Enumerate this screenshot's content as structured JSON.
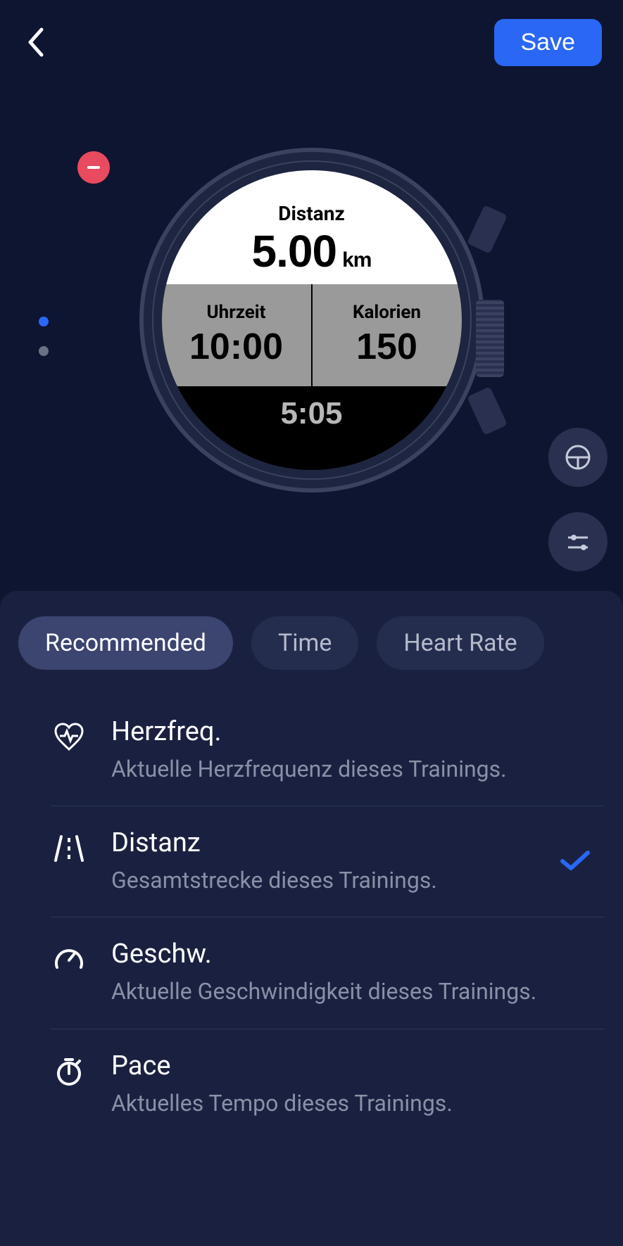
{
  "header": {
    "save_label": "Save"
  },
  "watch": {
    "top": {
      "label": "Distanz",
      "value": "5.00",
      "unit": "km"
    },
    "mid_left": {
      "label": "Uhrzeit",
      "value": "10:00"
    },
    "mid_right": {
      "label": "Kalorien",
      "value": "150"
    },
    "bottom": {
      "value": "5:05"
    }
  },
  "tabs": [
    "Recommended",
    "Time",
    "Heart Rate"
  ],
  "items": [
    {
      "title": "Herzfreq.",
      "desc": "Aktuelle Herzfrequenz dieses Trainings.",
      "selected": false
    },
    {
      "title": "Distanz",
      "desc": "Gesamtstrecke dieses Trainings.",
      "selected": true
    },
    {
      "title": "Geschw.",
      "desc": "Aktuelle Geschwindigkeit dieses Trainings.",
      "selected": false
    },
    {
      "title": "Pace",
      "desc": "Aktuelles Tempo dieses Trainings.",
      "selected": false
    }
  ]
}
